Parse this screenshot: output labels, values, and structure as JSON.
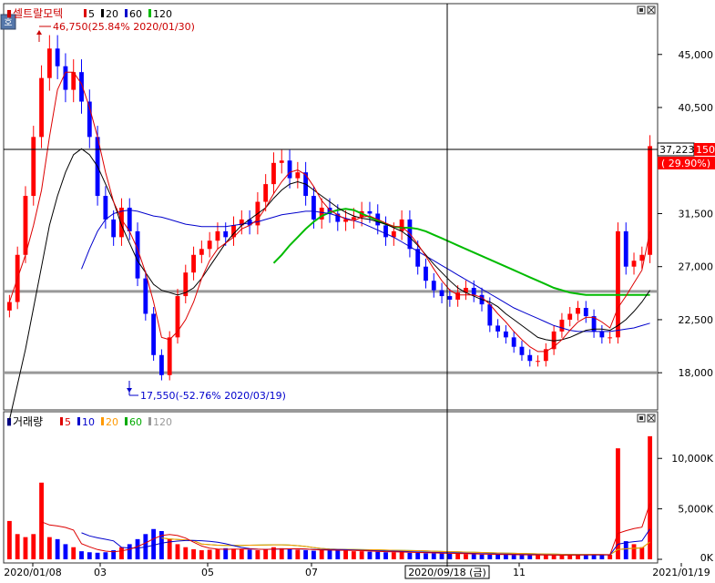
{
  "price_panel": {
    "stock_name": "셀트랄모텍",
    "ma_legend": [
      {
        "label": "5",
        "color": "#dd0000"
      },
      {
        "label": "20",
        "color": "#000000"
      },
      {
        "label": "60",
        "color": "#0000cc"
      },
      {
        "label": "120",
        "color": "#00bb00"
      }
    ],
    "small_icon": "호",
    "high_annotation": "46,750(25.84% 2020/01/30)",
    "low_annotation": "17,550(-52.76% 2020/03/19)",
    "current_price": "37,223",
    "current_suffix": "150",
    "current_change": "( 29.90%)",
    "price_scale": [
      {
        "label": "45,000",
        "value": 45000
      },
      {
        "label": "40,500",
        "value": 40500
      },
      {
        "label": "31,500",
        "value": 31500
      },
      {
        "label": "27,000",
        "value": 27000
      },
      {
        "label": "22,500",
        "value": 22500
      },
      {
        "label": "18,000",
        "value": 18000
      }
    ]
  },
  "volume_panel": {
    "title": "거래량",
    "ma_legend": [
      {
        "label": "5",
        "color": "#dd0000"
      },
      {
        "label": "10",
        "color": "#0000cc"
      },
      {
        "label": "20",
        "color": "#ff9900"
      },
      {
        "label": "60",
        "color": "#00aa00"
      },
      {
        "label": "120",
        "color": "#999999"
      }
    ],
    "volume_scale": [
      {
        "label": "10,000K",
        "value": 10000
      },
      {
        "label": "5,000K",
        "value": 5000
      },
      {
        "label": "0K",
        "value": 0
      }
    ]
  },
  "x_axis": {
    "labels": [
      "2020/01/08",
      "03",
      "05",
      "07",
      "2020/09/18 (금)",
      "11",
      "2021/01/19"
    ]
  },
  "colors": {
    "up": "#ff0000",
    "down": "#0000ff",
    "ma5": "#dd0000",
    "ma20": "#000000",
    "ma60": "#0000cc",
    "ma120": "#00bb00",
    "support": "#999999"
  },
  "chart_data": {
    "type": "candlestick",
    "date_range": [
      "2020/01/08",
      "2021/01/19"
    ],
    "y_range": [
      15000,
      49000
    ],
    "highest": {
      "price": 46750,
      "change_pct": 25.84,
      "date": "2020/01/30"
    },
    "lowest": {
      "price": 17550,
      "change_pct": -52.76,
      "date": "2020/03/19"
    },
    "current": {
      "price": 37223,
      "change_pct": 29.9
    },
    "horizontal_lines": [
      24900,
      18000
    ],
    "close_series": [
      24000,
      28000,
      33000,
      38000,
      43000,
      45500,
      44000,
      42000,
      43500,
      41000,
      38000,
      33000,
      31000,
      29500,
      32000,
      30000,
      26000,
      23000,
      19500,
      17800,
      21000,
      24500,
      26500,
      28000,
      28500,
      29200,
      30000,
      29500,
      30500,
      31000,
      30500,
      32500,
      34000,
      35800,
      36000,
      34500,
      35000,
      33000,
      31000,
      32000,
      31500,
      30800,
      31000,
      31200,
      31700,
      31500,
      30500,
      29500,
      30000,
      31000,
      28500,
      27000,
      25800,
      25000,
      24500,
      24200,
      24800,
      25200,
      24600,
      23800,
      22000,
      21500,
      21000,
      20200,
      19500,
      19000,
      19000,
      20000,
      21500,
      22500,
      23000,
      23500,
      22800,
      21500,
      21000,
      21000,
      30000,
      27000,
      27500,
      28000,
      37223
    ],
    "ma_lines": {
      "ma5": [
        24000,
        26000,
        28000,
        30500,
        33500,
        38000,
        42000,
        43500,
        43500,
        42500,
        40500,
        38000,
        35000,
        32500,
        31000,
        30000,
        28500,
        26500,
        24000,
        21000,
        20800,
        21500,
        22500,
        24000,
        26000,
        27500,
        28500,
        29000,
        29500,
        30200,
        30500,
        31000,
        32000,
        33200,
        34200,
        35000,
        35200,
        34800,
        33800,
        32600,
        31800,
        31400,
        31000,
        30900,
        31200,
        31300,
        31000,
        30700,
        30400,
        30400,
        29800,
        28900,
        27900,
        26800,
        25800,
        25000,
        24600,
        24600,
        24600,
        24400,
        23800,
        23000,
        22300,
        21500,
        20800,
        20200,
        19800,
        19800,
        20200,
        20800,
        21600,
        22300,
        22700,
        22700,
        22300,
        21800,
        23500,
        24500,
        25600,
        26700,
        30000
      ],
      "ma20": [
        14000,
        17000,
        20000,
        23500,
        27000,
        30500,
        33000,
        35000,
        36500,
        37000,
        36500,
        35500,
        34000,
        32500,
        30500,
        29000,
        27500,
        26500,
        25500,
        25000,
        24800,
        24600,
        24800,
        25200,
        26000,
        27000,
        28000,
        29000,
        29800,
        30500,
        31000,
        31500,
        32000,
        32800,
        33500,
        34000,
        34200,
        34000,
        33500,
        33000,
        32500,
        32000,
        31600,
        31300,
        31100,
        31000,
        30800,
        30600,
        30300,
        30000,
        29500,
        28800,
        28000,
        27200,
        26500,
        25800,
        25200,
        24800,
        24500,
        24200,
        24000,
        23600,
        23000,
        22500,
        22000,
        21500,
        21000,
        20800,
        20700,
        20800,
        21000,
        21300,
        21600,
        21700,
        21700,
        21600,
        22000,
        22500,
        23200,
        24000,
        25000
      ],
      "ma60": [
        null,
        null,
        null,
        null,
        null,
        null,
        null,
        null,
        null,
        26800,
        28500,
        30000,
        31000,
        31500,
        31700,
        31800,
        31700,
        31500,
        31300,
        31200,
        31000,
        30800,
        30600,
        30500,
        30400,
        30400,
        30400,
        30400,
        30500,
        30600,
        30700,
        30800,
        31000,
        31200,
        31400,
        31500,
        31600,
        31700,
        31700,
        31600,
        31500,
        31300,
        31100,
        30900,
        30700,
        30400,
        30100,
        29800,
        29500,
        29100,
        28700,
        28300,
        27900,
        27500,
        27100,
        26700,
        26300,
        25900,
        25500,
        25100,
        24700,
        24300,
        23900,
        23500,
        23200,
        22900,
        22600,
        22300,
        22000,
        21800,
        21600,
        21500,
        21500,
        21500,
        21500,
        21500,
        21600,
        21700,
        21800,
        22000,
        22200
      ],
      "ma120": [
        null,
        null,
        null,
        null,
        null,
        null,
        null,
        null,
        null,
        null,
        null,
        null,
        null,
        null,
        null,
        null,
        null,
        null,
        null,
        null,
        null,
        null,
        null,
        null,
        null,
        null,
        null,
        null,
        null,
        null,
        null,
        null,
        null,
        27300,
        28000,
        28800,
        29500,
        30200,
        30800,
        31300,
        31600,
        31800,
        31900,
        31800,
        31500,
        31200,
        30900,
        30600,
        30400,
        30300,
        30300,
        30200,
        30000,
        29700,
        29400,
        29100,
        28800,
        28500,
        28200,
        27900,
        27600,
        27300,
        27000,
        26700,
        26400,
        26100,
        25800,
        25500,
        25200,
        25000,
        24800,
        24700,
        24600,
        24600,
        24600,
        24600,
        24600,
        24600,
        24600,
        24600,
        24600
      ]
    },
    "volume_series": [
      3800,
      2500,
      2200,
      2500,
      3800,
      2200,
      2000,
      1500,
      1200,
      800,
      700,
      650,
      700,
      900,
      1200,
      1500,
      2000,
      2500,
      3000,
      2800,
      2000,
      1500,
      1200,
      1000,
      900,
      950,
      1000,
      1100,
      1050,
      1000,
      950,
      900,
      1000,
      1200,
      1100,
      1000,
      950,
      900,
      850,
      900,
      950,
      900,
      850,
      800,
      800,
      750,
      750,
      700,
      700,
      700,
      650,
      650,
      600,
      600,
      580,
      560,
      540,
      520,
      500,
      480,
      470,
      460,
      450,
      440,
      430,
      420,
      410,
      400,
      400,
      420,
      450,
      470,
      480,
      470,
      450,
      450,
      2500,
      1800,
      1500,
      1200,
      2600
    ],
    "volume_spikes": [
      {
        "index": 4,
        "value": 7600
      },
      {
        "index": 76,
        "value": 11000
      },
      {
        "index": 80,
        "value": 12200
      }
    ],
    "volume_ylim": [
      0,
      13000
    ]
  }
}
